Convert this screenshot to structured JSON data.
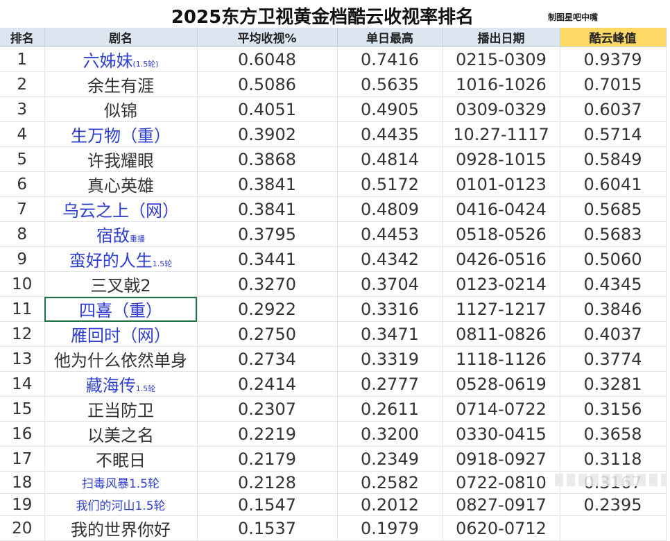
{
  "title": "2025东方卫视黄金档酷云收视率排名",
  "credit": "制图星吧中嘴",
  "colors": {
    "header_bg": "#dce6f1",
    "peak_header_bg": "#ffd966",
    "blue_text": "#2e3fcf",
    "selection": "#1e7145"
  },
  "headers": [
    "排名",
    "剧名",
    "平均收视%",
    "单日最高",
    "播出日期",
    "酷云峰值"
  ],
  "rows": [
    {
      "rank": "1",
      "name": "六姊妹",
      "suffix": "(1.5轮)",
      "blue": true,
      "avg": "0.6048",
      "high": "0.7416",
      "dates": "0215-0309",
      "peak": "0.9379"
    },
    {
      "rank": "2",
      "name": "余生有涯",
      "suffix": "",
      "blue": false,
      "avg": "0.5086",
      "high": "0.5635",
      "dates": "1016-1026",
      "peak": "0.7015"
    },
    {
      "rank": "3",
      "name": "似锦",
      "suffix": "",
      "blue": false,
      "avg": "0.4051",
      "high": "0.4905",
      "dates": "0309-0329",
      "peak": "0.6037"
    },
    {
      "rank": "4",
      "name": "生万物（重）",
      "suffix": "",
      "blue": true,
      "avg": "0.3902",
      "high": "0.4435",
      "dates": "10.27-1117",
      "peak": "0.5714"
    },
    {
      "rank": "5",
      "name": "许我耀眼",
      "suffix": "",
      "blue": false,
      "avg": "0.3868",
      "high": "0.4814",
      "dates": "0928-1015",
      "peak": "0.5849"
    },
    {
      "rank": "6",
      "name": "真心英雄",
      "suffix": "",
      "blue": false,
      "avg": "0.3841",
      "high": "0.5172",
      "dates": "0101-0123",
      "peak": "0.6041"
    },
    {
      "rank": "7",
      "name": "乌云之上（网）",
      "suffix": "",
      "blue": true,
      "avg": "0.3841",
      "high": "0.4809",
      "dates": "0416-0424",
      "peak": "0.5685"
    },
    {
      "rank": "8",
      "name": "宿敌",
      "suffix": "重播",
      "blue": true,
      "avg": "0.3795",
      "high": "0.4453",
      "dates": "0518-0526",
      "peak": "0.5683"
    },
    {
      "rank": "9",
      "name": "蛮好的人生",
      "suffix": "1.5轮",
      "blue": true,
      "avg": "0.3441",
      "high": "0.4342",
      "dates": "0426-0516",
      "peak": "0.5060"
    },
    {
      "rank": "10",
      "name": "三叉戟2",
      "suffix": "",
      "blue": false,
      "avg": "0.3270",
      "high": "0.3704",
      "dates": "0123-0214",
      "peak": "0.4345"
    },
    {
      "rank": "11",
      "name": "四喜（重）",
      "suffix": "",
      "blue": true,
      "selected": true,
      "avg": "0.2922",
      "high": "0.3316",
      "dates": "1127-1217",
      "peak": "0.3846"
    },
    {
      "rank": "12",
      "name": "雁回时（网）",
      "suffix": "",
      "blue": true,
      "avg": "0.2750",
      "high": "0.3471",
      "dates": "0811-0826",
      "peak": "0.4037"
    },
    {
      "rank": "13",
      "name": "他为什么依然单身",
      "suffix": "",
      "blue": false,
      "avg": "0.2734",
      "high": "0.3319",
      "dates": "1118-1126",
      "peak": "0.3774"
    },
    {
      "rank": "14",
      "name": "藏海传",
      "suffix": "1.5轮",
      "blue": true,
      "avg": "0.2414",
      "high": "0.2777",
      "dates": "0528-0619",
      "peak": "0.3281"
    },
    {
      "rank": "15",
      "name": "正当防卫",
      "suffix": "",
      "blue": false,
      "avg": "0.2307",
      "high": "0.2611",
      "dates": "0714-0722",
      "peak": "0.3156"
    },
    {
      "rank": "16",
      "name": "以美之名",
      "suffix": "",
      "blue": false,
      "avg": "0.2219",
      "high": "0.3200",
      "dates": "0330-0415",
      "peak": "0.3658"
    },
    {
      "rank": "17",
      "name": "不眠日",
      "suffix": "",
      "blue": false,
      "avg": "0.2179",
      "high": "0.2349",
      "dates": "0918-0927",
      "peak": "0.3118"
    },
    {
      "rank": "18",
      "name": "扫毒风暴1.5轮",
      "suffix": "",
      "blue": true,
      "small": true,
      "avg": "0.2128",
      "high": "0.2582",
      "dates": "0722-0810",
      "peak": "0.3167"
    },
    {
      "rank": "19",
      "name": "我们的河山1.5轮",
      "suffix": "",
      "blue": true,
      "small": true,
      "avg": "0.1547",
      "high": "0.2012",
      "dates": "0827-0917",
      "peak": "0.2395"
    },
    {
      "rank": "20",
      "name": "我的世界你好",
      "suffix": "",
      "blue": false,
      "avg": "0.1537",
      "high": "0.1979",
      "dates": "0620-0712",
      "peak": ""
    }
  ]
}
